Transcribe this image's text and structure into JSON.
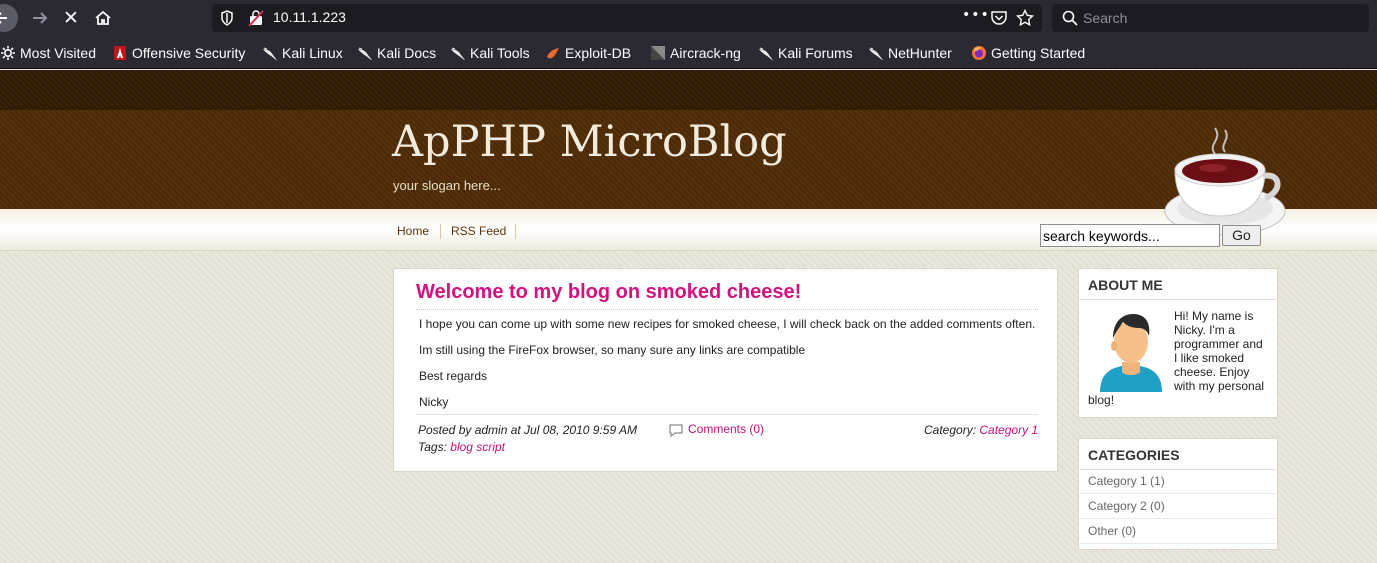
{
  "browser": {
    "url": "10.11.1.223",
    "search_placeholder": "Search",
    "more_glyph": "•••",
    "nav": {
      "stop_glyph": "✕"
    }
  },
  "bookmarks": [
    {
      "label": "Most Visited",
      "icon": "gear-icon"
    },
    {
      "label": "Offensive Security",
      "icon": "offsec-icon"
    },
    {
      "label": "Kali Linux",
      "icon": "kali-dragon-icon"
    },
    {
      "label": "Kali Docs",
      "icon": "kali-dragon-icon"
    },
    {
      "label": "Kali Tools",
      "icon": "kali-dragon-icon"
    },
    {
      "label": "Exploit-DB",
      "icon": "exploitdb-icon"
    },
    {
      "label": "Aircrack-ng",
      "icon": "aircrack-icon"
    },
    {
      "label": "Kali Forums",
      "icon": "kali-dragon-icon"
    },
    {
      "label": "NetHunter",
      "icon": "kali-dragon-icon"
    },
    {
      "label": "Getting Started",
      "icon": "firefox-icon"
    }
  ],
  "site": {
    "title": "ApPHP MicroBlog",
    "slogan": "your slogan here...",
    "menu": [
      "Home",
      "RSS Feed"
    ],
    "search_value": "search keywords...",
    "go_label": "Go"
  },
  "post": {
    "title": "Welcome to my blog on smoked cheese!",
    "paragraphs": [
      "I hope you can come up with some new recipes for smoked cheese, I will check back on the added comments often.",
      "Im still using the FireFox browser, so many sure any links are compatible",
      "Best regards",
      "Nicky"
    ],
    "posted_by": "Posted by admin at Jul 08, 2010 9:59 AM",
    "comments": "Comments (0)",
    "category_label": "Category:",
    "category_value": "Category 1",
    "tags_label": "Tags:",
    "tags_value": "blog script"
  },
  "about": {
    "heading": "ABOUT ME",
    "lines": [
      "Hi! My name is",
      "Nicky. I'm a",
      "programmer and",
      "I like smoked",
      "cheese. Enjoy",
      "with my personal"
    ],
    "last_line": "blog!"
  },
  "categories": {
    "heading": "CATEGORIES",
    "items": [
      "Category 1 (1)",
      "Category 2 (0)",
      "Other (0)"
    ]
  },
  "colors": {
    "accent_pink": "#d4127f",
    "header_brown": "#4a2a08",
    "browser_chrome": "#2b2a33"
  }
}
